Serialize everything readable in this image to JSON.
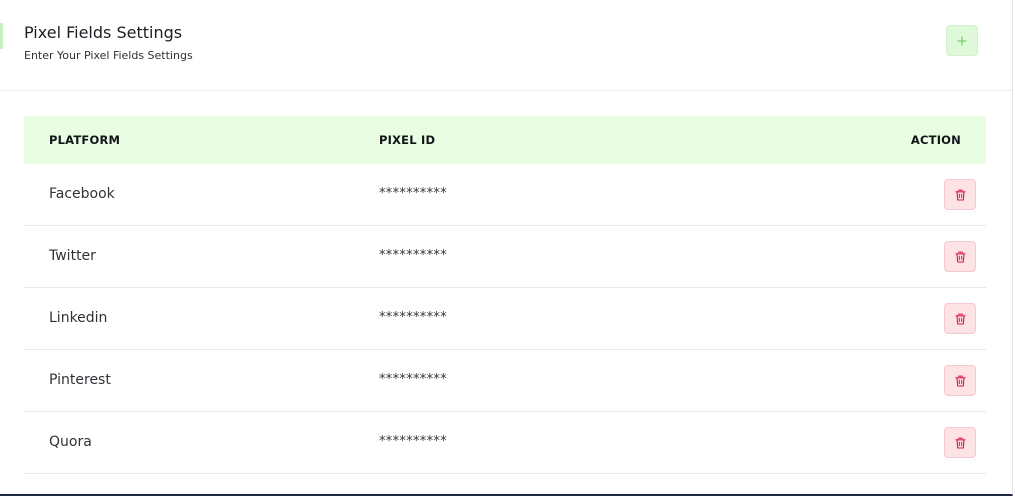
{
  "header": {
    "title": "Pixel Fields Settings",
    "subtitle": "Enter Your Pixel Fields Settings",
    "add_icon": "plus-icon"
  },
  "table": {
    "columns": {
      "platform": "PLATFORM",
      "pixel_id": "PIXEL ID",
      "action": "ACTION"
    },
    "rows": [
      {
        "platform": "Facebook",
        "pixel_id": "**********",
        "action_icon": "trash-icon"
      },
      {
        "platform": "Twitter",
        "pixel_id": "**********",
        "action_icon": "trash-icon"
      },
      {
        "platform": "Linkedin",
        "pixel_id": "**********",
        "action_icon": "trash-icon"
      },
      {
        "platform": "Pinterest",
        "pixel_id": "**********",
        "action_icon": "trash-icon"
      },
      {
        "platform": "Quora",
        "pixel_id": "**********",
        "action_icon": "trash-icon"
      }
    ]
  },
  "colors": {
    "header_bg": "#e8fde2",
    "add_button_bg": "#dff8d9",
    "add_icon": "#6fd35c",
    "delete_button_bg": "#fde2e6",
    "delete_icon": "#d81b44"
  }
}
